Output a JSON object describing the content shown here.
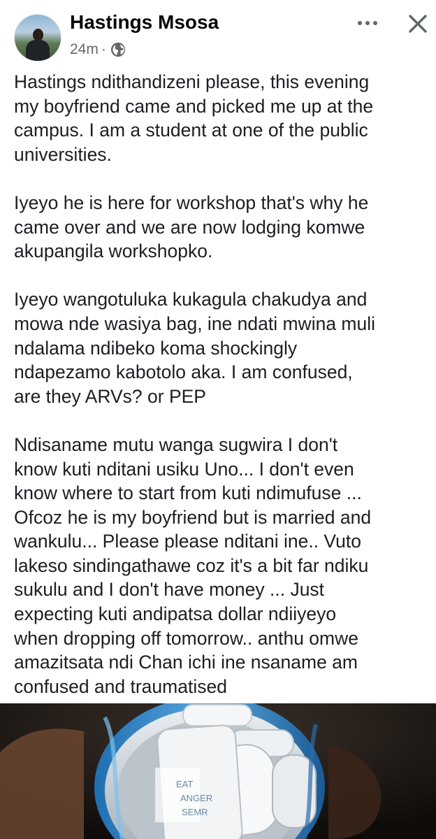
{
  "post": {
    "author": "Hastings Msosa",
    "time": "24m",
    "separator": "·",
    "privacy_icon": "globe-icon",
    "paragraphs": [
      "Hastings ndithandizeni please, this evening\nmy boyfriend came and picked me up at the\ncampus. I am a student at one of the public\nuniversities.",
      "Iyeyo he is here for workshop that's why he\ncame over and we are now lodging komwe\nakupangila workshopko.",
      "Iyeyo wangotuluka kukagula chakudya and\nmowa nde wasiya bag, ine ndati mwina muli\nndalama ndibeko  koma shockingly\nndapezamo kabotolo aka. I am confused,\nare they ARVs? or PEP",
      "Ndisaname mutu wanga sugwira I don't\nknow kuti nditani usiku Uno... I don't even\nknow where to start from kuti ndimufuse ...\nOfcoz he is my boyfriend but is married and\nwankulu... Please please nditani ine.. Vuto\nlakeso sindingathawe coz it's a bit far ndiku\nsukulu and I don't have money ... Just\nexpecting kuti andipatsa dollar ndiiyeyo\nwhen dropping off tomorrow.. anthu omwe\namazitsata ndi Chan ichi ine nsaname am\nconfused and traumatised"
    ],
    "photo": {
      "label_lines": [
        "EAT",
        "ANGER",
        "SEMR"
      ]
    }
  },
  "icons": {
    "more": "more-icon",
    "close": "close-icon"
  },
  "colors": {
    "name": "#050505",
    "text": "#1c1e21",
    "meta": "#65676b",
    "icon": "#606770"
  }
}
